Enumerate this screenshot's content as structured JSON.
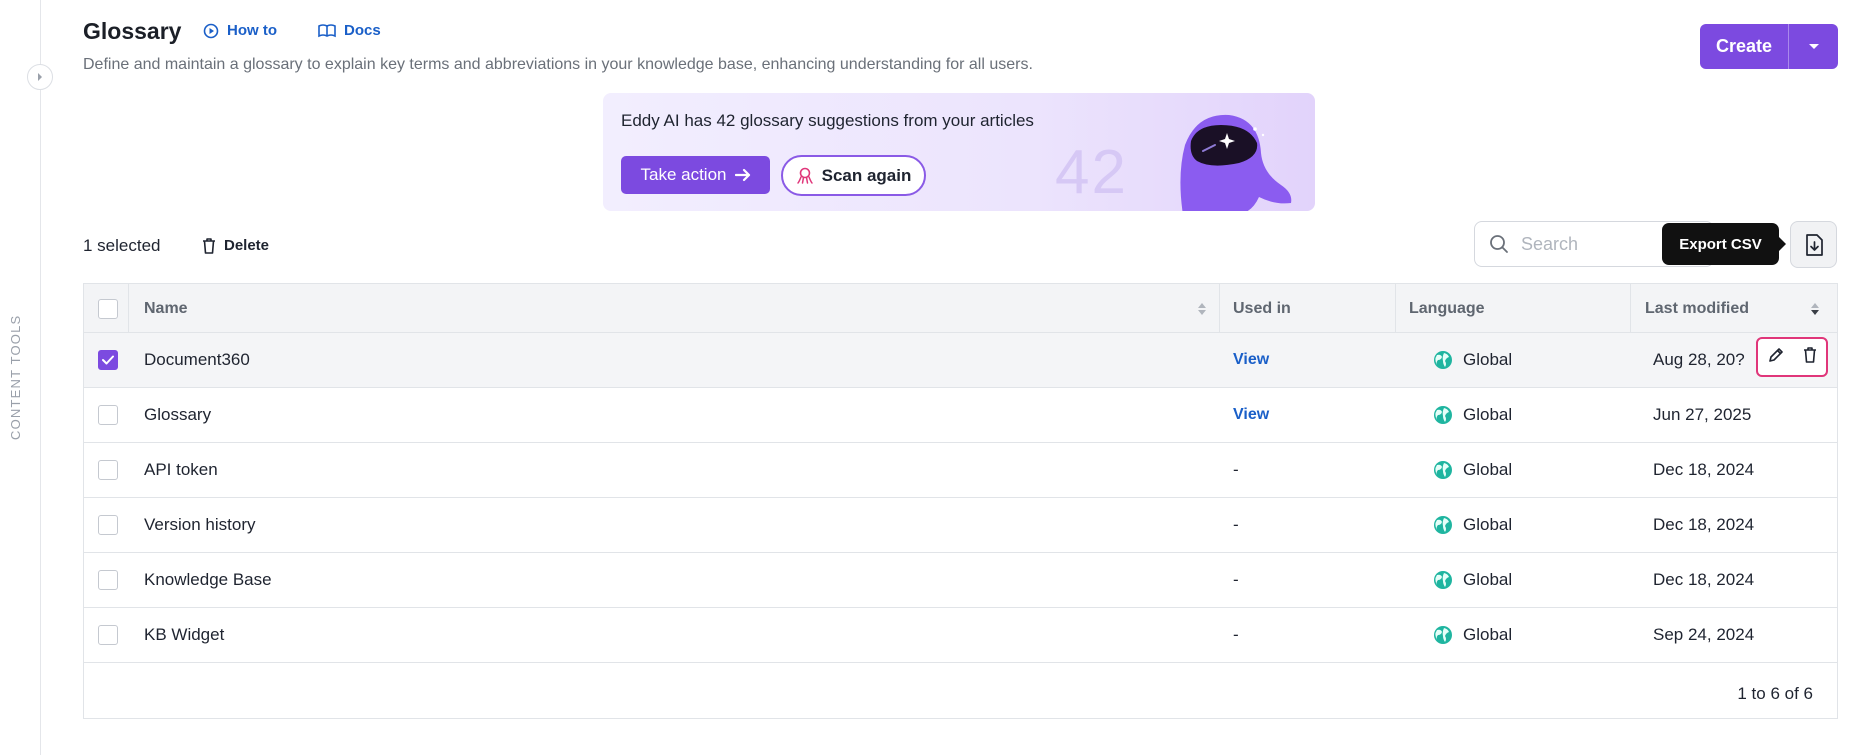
{
  "sidebar": {
    "label": "CONTENT TOOLS"
  },
  "header": {
    "title": "Glossary",
    "how_to": "How to",
    "docs": "Docs",
    "subtitle": "Define and maintain a glossary to explain key terms and abbreviations in your knowledge base, enhancing understanding for all users.",
    "create_label": "Create"
  },
  "banner": {
    "message": "Eddy AI has 42 glossary suggestions from your articles",
    "take_action": "Take action",
    "scan_again": "Scan again",
    "count": "42"
  },
  "toolbar": {
    "selected": "1 selected",
    "delete": "Delete",
    "search_placeholder": "Search",
    "export_tooltip": "Export CSV"
  },
  "table": {
    "columns": {
      "name": "Name",
      "used_in": "Used in",
      "language": "Language",
      "last_modified": "Last modified"
    },
    "rows": [
      {
        "name": "Document360",
        "used_in": "View",
        "language": "Global",
        "last_modified": "Aug 28, 20?",
        "selected": true
      },
      {
        "name": "Glossary",
        "used_in": "View",
        "language": "Global",
        "last_modified": "Jun 27, 2025",
        "selected": false
      },
      {
        "name": "API token",
        "used_in": "-",
        "language": "Global",
        "last_modified": "Dec 18, 2024",
        "selected": false
      },
      {
        "name": "Version history",
        "used_in": "-",
        "language": "Global",
        "last_modified": "Dec 18, 2024",
        "selected": false
      },
      {
        "name": "Knowledge Base",
        "used_in": "-",
        "language": "Global",
        "last_modified": "Dec 18, 2024",
        "selected": false
      },
      {
        "name": "KB Widget",
        "used_in": "-",
        "language": "Global",
        "last_modified": "Sep 24, 2024",
        "selected": false
      }
    ],
    "pagination": "1 to 6 of 6"
  },
  "colors": {
    "accent": "#7c4ae0",
    "link": "#1a5fc8",
    "highlight": "#e0367a"
  }
}
